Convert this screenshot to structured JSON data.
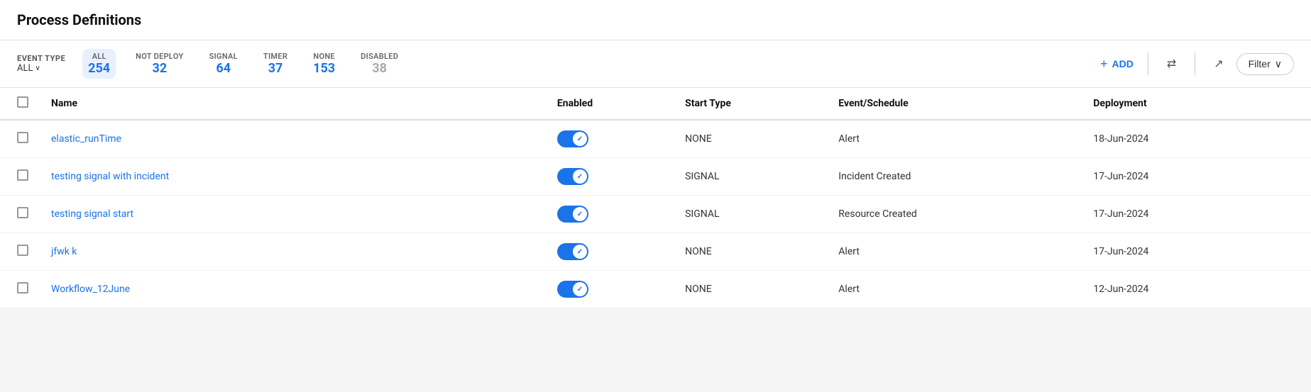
{
  "page": {
    "title": "Process Definitions"
  },
  "toolbar": {
    "event_type_label": "EVENT TYPE",
    "event_type_value": "ALL",
    "chevron": "∨",
    "tabs": [
      {
        "id": "all",
        "label": "ALL",
        "count": "254",
        "active": true,
        "disabled": false
      },
      {
        "id": "not_deploy",
        "label": "NOT DEPLOY",
        "count": "32",
        "active": false,
        "disabled": false
      },
      {
        "id": "signal",
        "label": "SIGNAL",
        "count": "64",
        "active": false,
        "disabled": false
      },
      {
        "id": "timer",
        "label": "TIMER",
        "count": "37",
        "active": false,
        "disabled": false
      },
      {
        "id": "none",
        "label": "NONE",
        "count": "153",
        "active": false,
        "disabled": false
      },
      {
        "id": "disabled",
        "label": "DISABLED",
        "count": "38",
        "active": false,
        "disabled": true
      }
    ],
    "add_label": "ADD",
    "filter_label": "Filter"
  },
  "table": {
    "columns": [
      {
        "id": "name",
        "label": "Name"
      },
      {
        "id": "enabled",
        "label": "Enabled"
      },
      {
        "id": "start_type",
        "label": "Start Type"
      },
      {
        "id": "event_schedule",
        "label": "Event/Schedule"
      },
      {
        "id": "deployment",
        "label": "Deployment"
      }
    ],
    "rows": [
      {
        "id": 1,
        "name": "elastic_runTime",
        "enabled": true,
        "start_type": "NONE",
        "event_schedule": "Alert",
        "deployment": "18-Jun-2024"
      },
      {
        "id": 2,
        "name": "testing signal with incident",
        "enabled": true,
        "start_type": "SIGNAL",
        "event_schedule": "Incident Created",
        "deployment": "17-Jun-2024"
      },
      {
        "id": 3,
        "name": "testing signal start",
        "enabled": true,
        "start_type": "SIGNAL",
        "event_schedule": "Resource Created",
        "deployment": "17-Jun-2024"
      },
      {
        "id": 4,
        "name": "jfwk k",
        "enabled": true,
        "start_type": "NONE",
        "event_schedule": "Alert",
        "deployment": "17-Jun-2024"
      },
      {
        "id": 5,
        "name": "Workflow_12June",
        "enabled": true,
        "start_type": "NONE",
        "event_schedule": "Alert",
        "deployment": "12-Jun-2024"
      }
    ]
  },
  "icons": {
    "plus": "+",
    "filter_lines": "≡",
    "download": "⬇",
    "chevron_down": "∨"
  }
}
